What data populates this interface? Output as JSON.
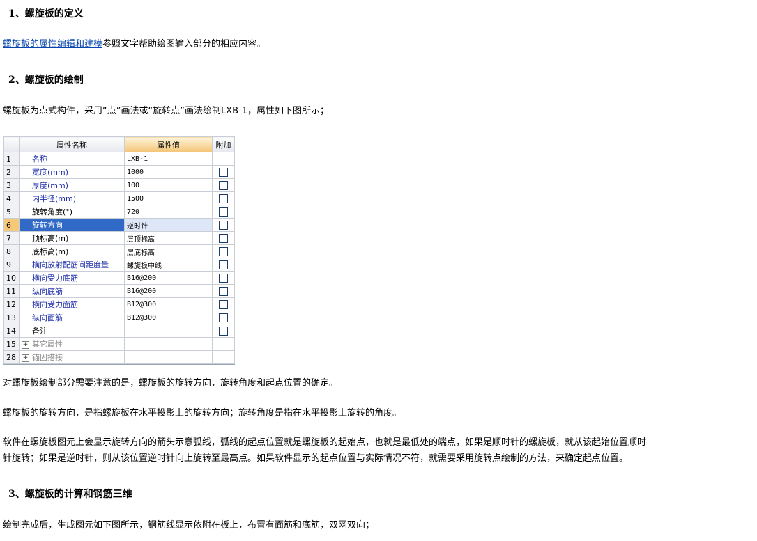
{
  "sections": [
    {
      "title": "1、螺旋板的定义"
    },
    {
      "title": "2、螺旋板的绘制"
    },
    {
      "title": "3、螺旋板的计算和钢筋三维"
    }
  ],
  "para1": {
    "link": "螺旋板的属性编辑和建模",
    "rest": "参照文字帮助绘图输入部分的相应内容。"
  },
  "para2": "螺旋板为点式构件，采用“点”画法或“旋转点”画法绘制LXB-1，属性如下图所示；",
  "grid": {
    "headers": {
      "index": "",
      "name": "属性名称",
      "value": "属性值",
      "extra": "附加"
    },
    "rows": [
      {
        "idx": "1",
        "name": "名称",
        "value": "LXB-1",
        "check": false,
        "color": "blue"
      },
      {
        "idx": "2",
        "name": "宽度(mm)",
        "value": "1000",
        "check": true,
        "color": "blue"
      },
      {
        "idx": "3",
        "name": "厚度(mm)",
        "value": "100",
        "check": true,
        "color": "blue"
      },
      {
        "idx": "4",
        "name": "内半径(mm)",
        "value": "1500",
        "check": true,
        "color": "blue"
      },
      {
        "idx": "5",
        "name": "旋转角度(°)",
        "value": "720",
        "check": true,
        "color": "black"
      },
      {
        "idx": "6",
        "name": "旋转方向",
        "value": "逆时针",
        "check": true,
        "color": "blue",
        "selected": true
      },
      {
        "idx": "7",
        "name": "顶标高(m)",
        "value": "层顶标高",
        "check": true,
        "color": "black"
      },
      {
        "idx": "8",
        "name": "底标高(m)",
        "value": "层底标高",
        "check": true,
        "color": "black"
      },
      {
        "idx": "9",
        "name": "横向放射配筋间距度量",
        "value": "螺旋板中线",
        "check": true,
        "color": "blue"
      },
      {
        "idx": "10",
        "name": "横向受力底筋",
        "value": "B16@200",
        "check": true,
        "color": "blue"
      },
      {
        "idx": "11",
        "name": "纵向底筋",
        "value": "B16@200",
        "check": true,
        "color": "blue"
      },
      {
        "idx": "12",
        "name": "横向受力面筋",
        "value": "B12@300",
        "check": true,
        "color": "blue"
      },
      {
        "idx": "13",
        "name": "纵向面筋",
        "value": "B12@300",
        "check": true,
        "color": "blue"
      },
      {
        "idx": "14",
        "name": "备注",
        "value": "",
        "check": true,
        "color": "black"
      },
      {
        "idx": "15",
        "name": "其它属性",
        "value": "",
        "check": false,
        "color": "gray",
        "group": true
      },
      {
        "idx": "28",
        "name": "锚固搭接",
        "value": "",
        "check": false,
        "color": "gray",
        "group": true
      }
    ]
  },
  "para3": "对螺旋板绘制部分需要注意的是，螺旋板的旋转方向，旋转角度和起点位置的确定。",
  "para4": "螺旋板的旋转方向，是指螺旋板在水平投影上的旋转方向；旋转角度是指在水平投影上旋转的角度。",
  "para5_line1": "软件在螺旋板图元上会显示旋转方向的箭头示意弧线，弧线的起点位置就是螺旋板的起始点，也就是最低处的端点，如果是顺时针的螺旋板，就从该起始位置顺时",
  "para5_line2": "针旋转；如果是逆时针，则从该位置逆时针向上旋转至最高点。如果软件显示的起点位置与实际情况不符，就需要采用旋转点绘制的方法，来确定起点位置。",
  "para6": "绘制完成后，生成图元如下图所示，钢筋线显示依附在板上，布置有面筋和底筋，双网双向；"
}
